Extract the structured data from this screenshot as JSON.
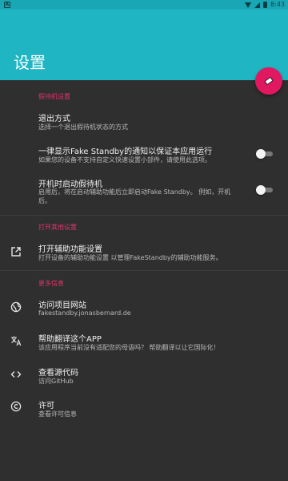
{
  "status_bar": {
    "notification_icon": "A",
    "time": "8:43"
  },
  "app_bar": {
    "title": "设置"
  },
  "sections": {
    "standby": "假待机设置",
    "other": "打开其他设置",
    "more": "更多信息"
  },
  "items": {
    "exit_mode": {
      "title": "退出方式",
      "subtitle": "选择一个退出假待机状态的方式"
    },
    "always_notify": {
      "title": "一律显示Fake Standby的通知以保证本应用运行",
      "subtitle": "如果您的设备不支持自定义快速设置小部件，请使用此选项。",
      "enabled": false
    },
    "boot_start": {
      "title": "开机时启动假待机",
      "subtitle": "启用后，将在启动辅助功能后立即启动Fake Standby。 例如，开机后。",
      "enabled": false
    },
    "accessibility": {
      "title": "打开辅助功能设置",
      "subtitle": "打开设备的辅助功能设置 以管理FakeStandby的辅助功能服务。",
      "icon": "open-in-new-icon"
    },
    "website": {
      "title": "访问项目网站",
      "subtitle": "fakestandby.jonasbernard.de",
      "icon": "globe-icon"
    },
    "translate": {
      "title": "帮助翻译这个APP",
      "subtitle": "该应用程序当前没有适配您的母语吗？ 帮助翻译以让它国际化！",
      "icon": "translate-icon"
    },
    "source": {
      "title": "查看源代码",
      "subtitle": "访问GitHub",
      "icon": "code-icon"
    },
    "license": {
      "title": "许可",
      "subtitle": "查看许可信息",
      "icon": "copyright-icon"
    }
  },
  "colors": {
    "toolbar": "#1fb5c2",
    "accent": "#e1175f",
    "section_header": "#e0346b",
    "background": "#2f2f2f"
  }
}
